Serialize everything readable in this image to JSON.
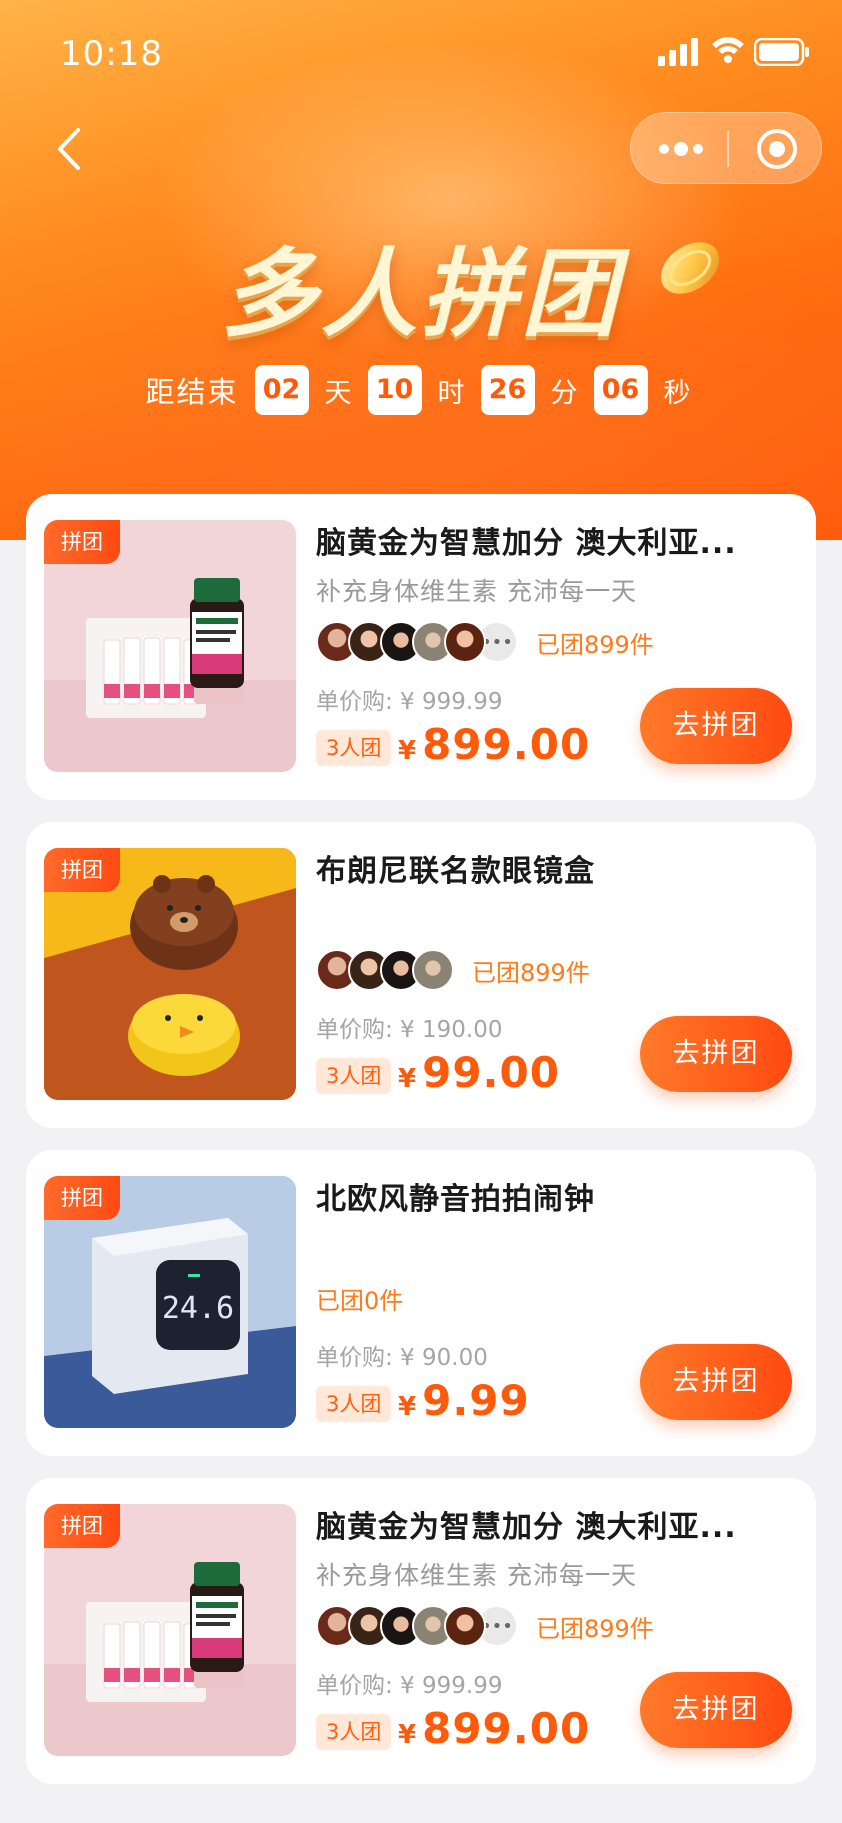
{
  "status_bar": {
    "time": "10:18"
  },
  "header": {
    "title": "多人拼团",
    "countdown": {
      "label": "距结束",
      "days": "02",
      "day_unit": "天",
      "hours": "10",
      "hour_unit": "时",
      "minutes": "26",
      "minute_unit": "分",
      "seconds": "06",
      "second_unit": "秒"
    }
  },
  "colors": {
    "accent": "#ff5a0a",
    "header_start": "#ffb347",
    "header_end": "#ff5a0a",
    "badge_bg": "#ffe8d8"
  },
  "products": [
    {
      "tag": "拼团",
      "title": "脑黄金为智慧加分 澳大利亚...",
      "subtitle": "补充身体维生素 充沛每一天",
      "avatars": [
        "avatar-1",
        "avatar-2",
        "avatar-3",
        "avatar-4",
        "avatar-5"
      ],
      "joined": "已团899件",
      "unit_price": "单价购: ¥ 999.99",
      "group_size": "3人团",
      "currency": "¥",
      "price": "899.00",
      "button": "去拼团",
      "image": "vitamin-bottles"
    },
    {
      "tag": "拼团",
      "title": "布朗尼联名款眼镜盒",
      "subtitle": "",
      "avatars": [
        "avatar-1",
        "avatar-2",
        "avatar-3",
        "avatar-4"
      ],
      "joined": "已团899件",
      "unit_price": "单价购: ¥ 190.00",
      "group_size": "3人团",
      "currency": "¥",
      "price": "99.00",
      "button": "去拼团",
      "image": "brown-sally-cases"
    },
    {
      "tag": "拼团",
      "title": "北欧风静音拍拍闹钟",
      "subtitle": "",
      "avatars": [],
      "joined": "已团0件",
      "unit_price": "单价购: ¥ 90.00",
      "group_size": "3人团",
      "currency": "¥",
      "price": "9.99",
      "button": "去拼团",
      "image": "digital-clock",
      "clock_reading": "24.6"
    },
    {
      "tag": "拼团",
      "title": "脑黄金为智慧加分 澳大利亚...",
      "subtitle": "补充身体维生素 充沛每一天",
      "avatars": [
        "avatar-1",
        "avatar-2",
        "avatar-3",
        "avatar-4",
        "avatar-5"
      ],
      "joined": "已团899件",
      "unit_price": "单价购: ¥ 999.99",
      "group_size": "3人团",
      "currency": "¥",
      "price": "899.00",
      "button": "去拼团",
      "image": "vitamin-bottles"
    }
  ]
}
